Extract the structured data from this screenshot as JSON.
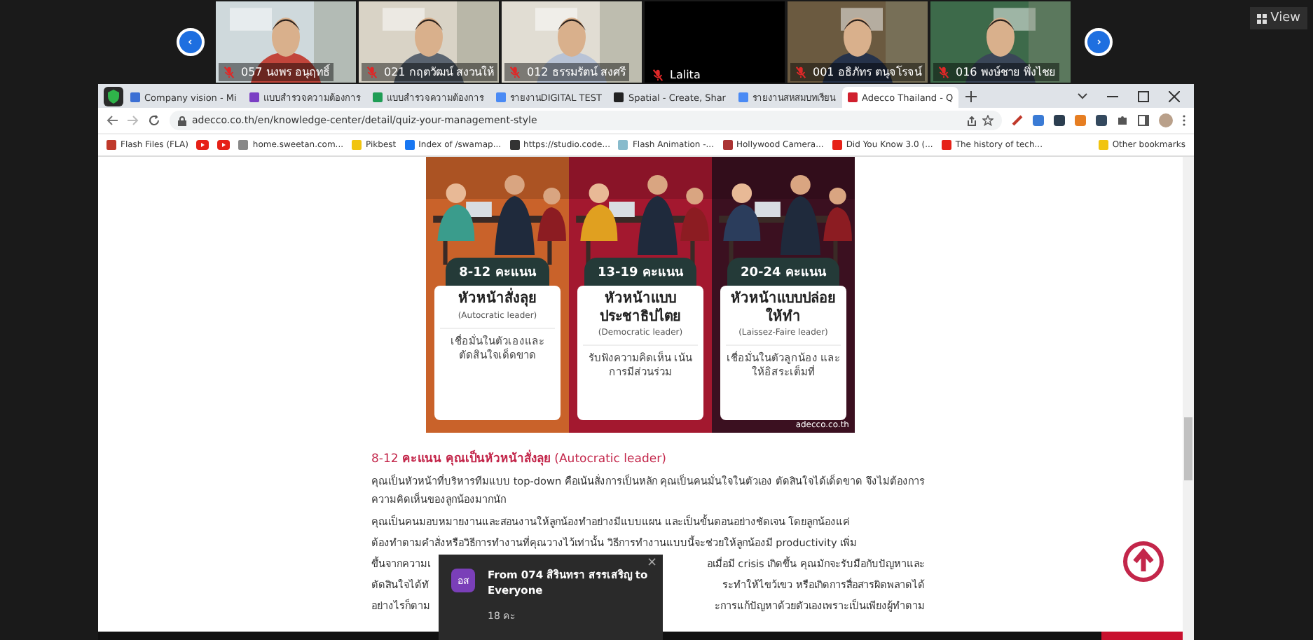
{
  "meeting": {
    "participants": [
      {
        "kind": "video",
        "name": "057 นงพร อนุฤทธิ์",
        "muted": true
      },
      {
        "kind": "video",
        "name": "021 กฤตวัฒน์ สงวนให้",
        "muted": true
      },
      {
        "kind": "video",
        "name": "012 ธรรมรัตน์ สงศรี",
        "muted": true
      },
      {
        "kind": "name",
        "name": "Lalita",
        "muted": true
      },
      {
        "kind": "video",
        "name": "001 อธิภัทร ตนุจโรจน์",
        "muted": true
      },
      {
        "kind": "video",
        "name": "016 พงษ์ชาย พึ่งไชย",
        "muted": true
      }
    ],
    "view_button": "View"
  },
  "browser": {
    "tabs": [
      {
        "label": "Company vision - Mi",
        "selected": false,
        "color": "#3b6fd4"
      },
      {
        "label": "แบบสำรวจความต้องการ",
        "selected": false,
        "color": "#7b3fc4"
      },
      {
        "label": "แบบสำรวจความต้องการ",
        "selected": false,
        "color": "#1f9d55"
      },
      {
        "label": "รายงานDIGITAL TEST",
        "selected": false,
        "color": "#4a8af4"
      },
      {
        "label": "Spatial - Create, Shar",
        "selected": false,
        "color": "#222222"
      },
      {
        "label": "รายงานสหสมบทเรียน",
        "selected": false,
        "color": "#4a8af4"
      },
      {
        "label": "Adecco Thailand - Q",
        "selected": true,
        "color": "#d0202e"
      }
    ],
    "address": "adecco.co.th/en/knowledge-center/detail/quiz-your-management-style",
    "bookmarks": [
      {
        "kind": "link",
        "label": "Flash Files (FLA)"
      },
      {
        "kind": "icon-only"
      },
      {
        "kind": "icon-only"
      },
      {
        "kind": "link",
        "label": "home.sweetan.com..."
      },
      {
        "kind": "link",
        "label": "Pikbest"
      },
      {
        "kind": "link",
        "label": "Index of /swamap..."
      },
      {
        "kind": "link",
        "label": "https://studio.code..."
      },
      {
        "kind": "link",
        "label": "Flash Animation -..."
      },
      {
        "kind": "link",
        "label": "Hollywood Camera..."
      },
      {
        "kind": "link",
        "label": "Did You Know 3.0 (..."
      },
      {
        "kind": "link",
        "label": "The history of tech..."
      }
    ],
    "other_bookmarks": "Other bookmarks"
  },
  "article": {
    "infographic": {
      "panels": [
        {
          "color": "#c9622a",
          "score": "8-12 คะแนน",
          "title": "หัวหน้าสั่งลุย",
          "subtitle": "(Autocratic leader)",
          "description": "เชื่อมั่นในตัวเองและตัดสินใจเด็ดขาด"
        },
        {
          "color": "#a3182f",
          "score": "13-19 คะแนน",
          "title": "หัวหน้าแบบประชาธิปไตย",
          "subtitle": "(Democratic leader)",
          "description": "รับฟังความคิดเห็น เน้นการมีส่วนร่วม"
        },
        {
          "color": "#3b1020",
          "score": "20-24 คะแนน",
          "title": "หัวหน้าแบบปล่อยให้ทำ",
          "subtitle": "(Laissez-Faire leader)",
          "description": "เชื่อมั่นในตัวลูกน้อง และให้อิสระเต็มที่"
        }
      ],
      "credit": "adecco.co.th"
    },
    "heading": "8-12 **คะแนน คุณเป็นหัวหน้าสั่งลุย** (Autocratic leader)",
    "paragraph": "คุณเป็นหัวหน้าที่บริหารทีมแบบ top-down คือเน้นสั่งการเป็นหลัก คุณเป็นคนมั่นใจในตัวเอง ตัดสินใจได้เด็ดขาด จึงไม่ต้องการความคิดเห็นของลูกน้องมากนัก",
    "lines": [
      {
        "left": "คุณเป็นคนมอบหมายงานและสอนงานให้ลูกน้องทำอย่างมีแบบแผน และเป็นขั้นตอนอย่างชัดเจน โดยลูกน้องแค่"
      },
      {
        "left": "ต้องทำตามคำสั่งหรือวิธีการทำงานที่คุณวางไว้เท่านั้น วิธีการทำงานแบบนี้จะช่วยให้ลูกน้องมี productivity เพิ่ม"
      },
      {
        "left": "ขึ้นจากความเ",
        "right": "อเมื่อมี crisis เกิดขึ้น คุณมักจะรับมือกับปัญหาและ"
      },
      {
        "left": "ตัดสินใจได้ทั",
        "right": "ระทำให้ไขว้เขว หรือเกิดการสื่อสารผิดพลาดได้"
      },
      {
        "left": "อย่างไรก็ตาม",
        "right": "ะการแก้ปัญหาด้วยตัวเองเพราะเป็นเพียงผู้ทำตาม"
      }
    ]
  },
  "notification": {
    "avatar": "อส",
    "title": "From 074 สิรินทรา สรรเสริญ to Everyone",
    "message": "18 คะ",
    "close": "×"
  }
}
